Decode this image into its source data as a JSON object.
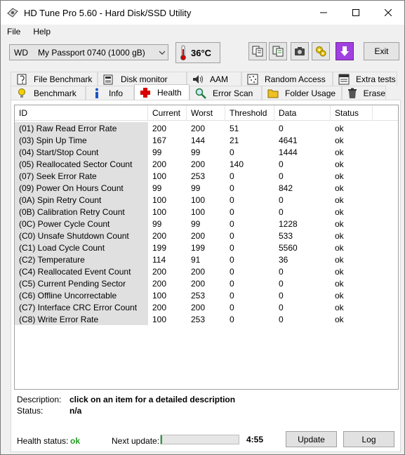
{
  "window": {
    "title": "HD Tune Pro 5.60 - Hard Disk/SSD Utility"
  },
  "menu": {
    "file": "File",
    "help": "Help"
  },
  "toolbar": {
    "drive_letter": "WD",
    "drive_name": "My Passport 0740 (1000 gB)",
    "temperature": "36°C",
    "exit_label": "Exit"
  },
  "tabs_top": [
    {
      "label": "File Benchmark",
      "icon": "file-benchmark-icon"
    },
    {
      "label": "Disk monitor",
      "icon": "disk-monitor-icon"
    },
    {
      "label": "AAM",
      "icon": "speaker-icon"
    },
    {
      "label": "Random Access",
      "icon": "random-access-icon"
    },
    {
      "label": "Extra tests",
      "icon": "extra-tests-icon"
    }
  ],
  "tabs_bottom": [
    {
      "label": "Benchmark",
      "icon": "lightbulb-icon"
    },
    {
      "label": "Info",
      "icon": "info-icon"
    },
    {
      "label": "Health",
      "icon": "health-cross-icon",
      "active": true
    },
    {
      "label": "Error Scan",
      "icon": "magnifier-icon"
    },
    {
      "label": "Folder Usage",
      "icon": "folder-icon"
    },
    {
      "label": "Erase",
      "icon": "trash-icon"
    }
  ],
  "table": {
    "headers": [
      "ID",
      "Current",
      "Worst",
      "Threshold",
      "Data",
      "Status"
    ],
    "rows": [
      [
        "(01) Raw Read Error Rate",
        "200",
        "200",
        "51",
        "0",
        "ok"
      ],
      [
        "(03) Spin Up Time",
        "167",
        "144",
        "21",
        "4641",
        "ok"
      ],
      [
        "(04) Start/Stop Count",
        "99",
        "99",
        "0",
        "1444",
        "ok"
      ],
      [
        "(05) Reallocated Sector Count",
        "200",
        "200",
        "140",
        "0",
        "ok"
      ],
      [
        "(07) Seek Error Rate",
        "100",
        "253",
        "0",
        "0",
        "ok"
      ],
      [
        "(09) Power On Hours Count",
        "99",
        "99",
        "0",
        "842",
        "ok"
      ],
      [
        "(0A) Spin Retry Count",
        "100",
        "100",
        "0",
        "0",
        "ok"
      ],
      [
        "(0B) Calibration Retry Count",
        "100",
        "100",
        "0",
        "0",
        "ok"
      ],
      [
        "(0C) Power Cycle Count",
        "99",
        "99",
        "0",
        "1228",
        "ok"
      ],
      [
        "(C0) Unsafe Shutdown Count",
        "200",
        "200",
        "0",
        "533",
        "ok"
      ],
      [
        "(C1) Load Cycle Count",
        "199",
        "199",
        "0",
        "5560",
        "ok"
      ],
      [
        "(C2) Temperature",
        "114",
        "91",
        "0",
        "36",
        "ok"
      ],
      [
        "(C4) Reallocated Event Count",
        "200",
        "200",
        "0",
        "0",
        "ok"
      ],
      [
        "(C5) Current Pending Sector",
        "200",
        "200",
        "0",
        "0",
        "ok"
      ],
      [
        "(C6) Offline Uncorrectable",
        "100",
        "253",
        "0",
        "0",
        "ok"
      ],
      [
        "(C7) Interface CRC Error Count",
        "200",
        "200",
        "0",
        "0",
        "ok"
      ],
      [
        "(C8) Write Error Rate",
        "100",
        "253",
        "0",
        "0",
        "ok"
      ]
    ]
  },
  "description": {
    "label": "Description:",
    "value": "click on an item for a detailed description",
    "status_label": "Status:",
    "status_value": "n/a"
  },
  "footer": {
    "health_label": "Health status:",
    "health_value": "ok",
    "health_color": "#22a022",
    "next_update_label": "Next update:",
    "progress_fraction": 0.02,
    "countdown": "4:55",
    "update_label": "Update",
    "log_label": "Log"
  }
}
